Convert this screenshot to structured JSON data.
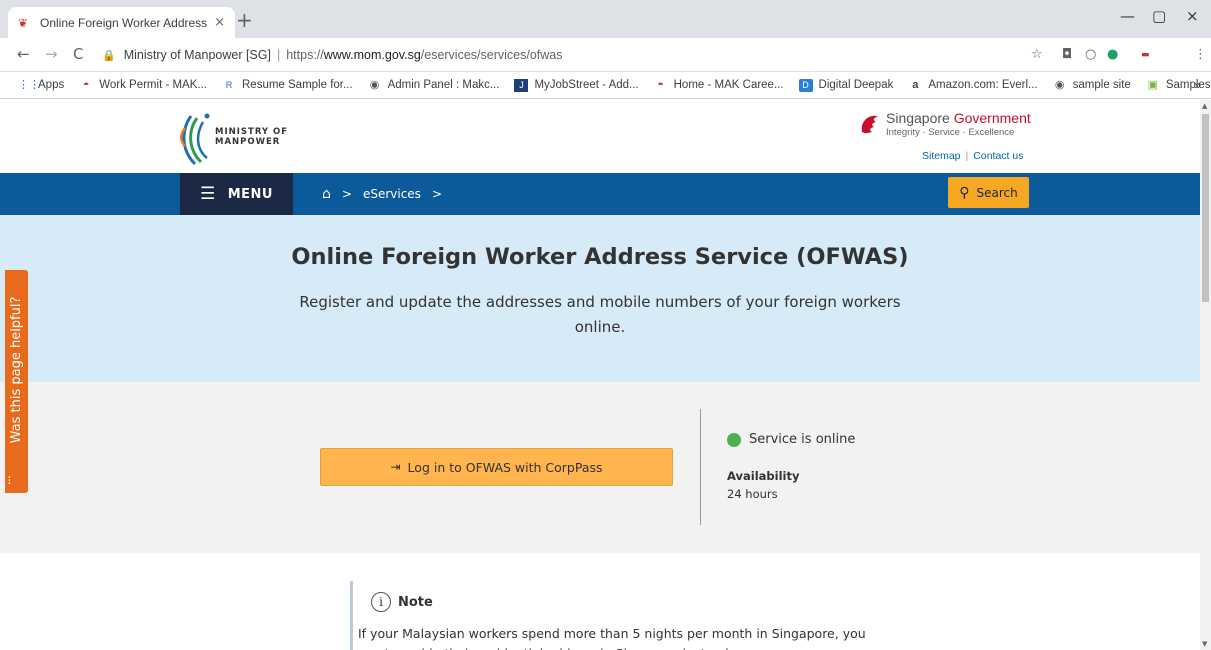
{
  "browser": {
    "tab_title": "Online Foreign Worker Address S",
    "tab_close": "×",
    "new_tab": "+",
    "win_min": "—",
    "win_restore": "▢",
    "win_close": "×",
    "site_name": "Ministry of Manpower [SG]",
    "separator": "|",
    "url_scheme": "https://",
    "url_domain": "www.mom.gov.sg",
    "url_path": "/eservices/services/ofwas",
    "bookmarks": [
      {
        "label": "Apps",
        "icon": "apps-grid-icon"
      },
      {
        "label": "Work Permit - MAK...",
        "icon": "mak-icon"
      },
      {
        "label": "Resume Sample for...",
        "icon": "resume-icon"
      },
      {
        "label": "Admin Panel : Makc...",
        "icon": "globe-icon"
      },
      {
        "label": "MyJobStreet - Add...",
        "icon": "jobstreet-icon"
      },
      {
        "label": "Home - MAK Caree...",
        "icon": "mak-icon"
      },
      {
        "label": "Digital Deepak",
        "icon": "digital-deepak-icon"
      },
      {
        "label": "Amazon.com: Everl...",
        "icon": "amazon-icon"
      },
      {
        "label": "sample site",
        "icon": "globe-icon"
      },
      {
        "label": "Samplesites",
        "icon": "folder-icon"
      }
    ],
    "bookmarks_more": "»"
  },
  "header": {
    "logo_line1": "MINISTRY OF",
    "logo_line2": "MANPOWER",
    "gov_line1a": "Singapore ",
    "gov_line1b": "Government",
    "gov_line2": "Integrity · Service · Excellence",
    "sitemap": "Sitemap",
    "link_sep": "|",
    "contact": "Contact us"
  },
  "nav": {
    "menu_label": "MENU",
    "home_icon": "⌂",
    "chevron": ">",
    "crumb_eservices": "eServices",
    "search_label": "Search"
  },
  "hero": {
    "title": "Online Foreign Worker Address Service (OFWAS)",
    "subtitle": "Register and update the addresses and mobile numbers of your foreign workers online."
  },
  "login": {
    "button_label": "Log in to OFWAS with CorpPass",
    "status_text": "Service is online",
    "status_color": "#4caf50",
    "availability_label": "Availability",
    "availability_value": "24 hours"
  },
  "note": {
    "heading": "Note",
    "text": "If your Malaysian workers spend more than 5 nights per month in Singapore, you must provide their residential address in Singapore instead."
  },
  "feedback": {
    "label": "Was this page helpful?"
  },
  "colors": {
    "nav_blue": "#0c5a99",
    "menu_dark": "#1c2944",
    "search_orange": "#f7a823",
    "hero_bg": "#d6eaf8",
    "login_btn": "#ffb44d",
    "feedback_orange": "#e86a1c"
  }
}
